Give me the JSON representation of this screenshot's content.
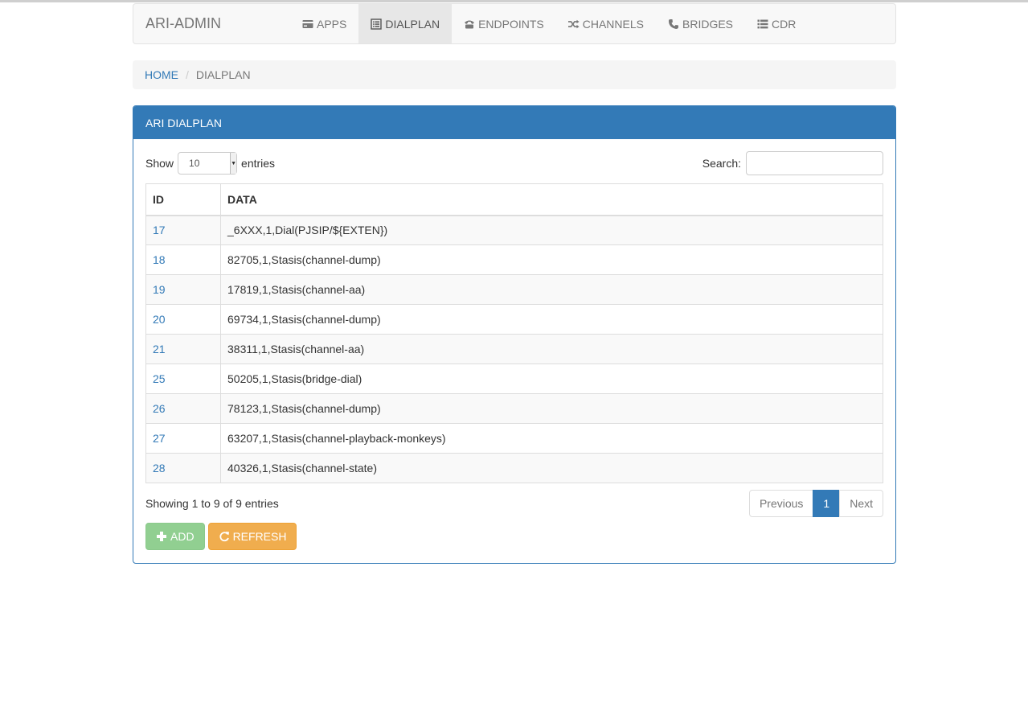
{
  "navbar": {
    "brand": "ARI-ADMIN",
    "items": [
      {
        "label": "APPS",
        "icon": "credit-card-icon"
      },
      {
        "label": "DIALPLAN",
        "icon": "list-alt-icon",
        "active": true
      },
      {
        "label": "ENDPOINTS",
        "icon": "phone-alt-icon"
      },
      {
        "label": "CHANNELS",
        "icon": "random-icon"
      },
      {
        "label": "BRIDGES",
        "icon": "earphone-icon"
      },
      {
        "label": "CDR",
        "icon": "list-icon"
      }
    ]
  },
  "breadcrumb": {
    "home": "HOME",
    "current": "DIALPLAN"
  },
  "panel": {
    "title": "ARI DIALPLAN",
    "show_label": "Show",
    "page_length": "10",
    "entries_label": "entries",
    "search_label": "Search:",
    "search_value": "",
    "columns": [
      "ID",
      "DATA"
    ],
    "rows": [
      {
        "id": "17",
        "data": "_6XXX,1,Dial(PJSIP/${EXTEN})"
      },
      {
        "id": "18",
        "data": "82705,1,Stasis(channel-dump)"
      },
      {
        "id": "19",
        "data": "17819,1,Stasis(channel-aa)"
      },
      {
        "id": "20",
        "data": "69734,1,Stasis(channel-dump)"
      },
      {
        "id": "21",
        "data": "38311,1,Stasis(channel-aa)"
      },
      {
        "id": "25",
        "data": "50205,1,Stasis(bridge-dial)"
      },
      {
        "id": "26",
        "data": "78123,1,Stasis(channel-dump)"
      },
      {
        "id": "27",
        "data": "63207,1,Stasis(channel-playback-monkeys)"
      },
      {
        "id": "28",
        "data": "40326,1,Stasis(channel-state)"
      }
    ],
    "info": "Showing 1 to 9 of 9 entries",
    "pagination": {
      "previous": "Previous",
      "current": "1",
      "next": "Next"
    },
    "buttons": {
      "add": "ADD",
      "add_icon": "plus-icon",
      "refresh": "REFRESH",
      "refresh_icon": "refresh-icon"
    }
  },
  "colors": {
    "primary": "#337ab7",
    "add_button": "#91cf91",
    "refresh_button": "#f0ad4e"
  }
}
